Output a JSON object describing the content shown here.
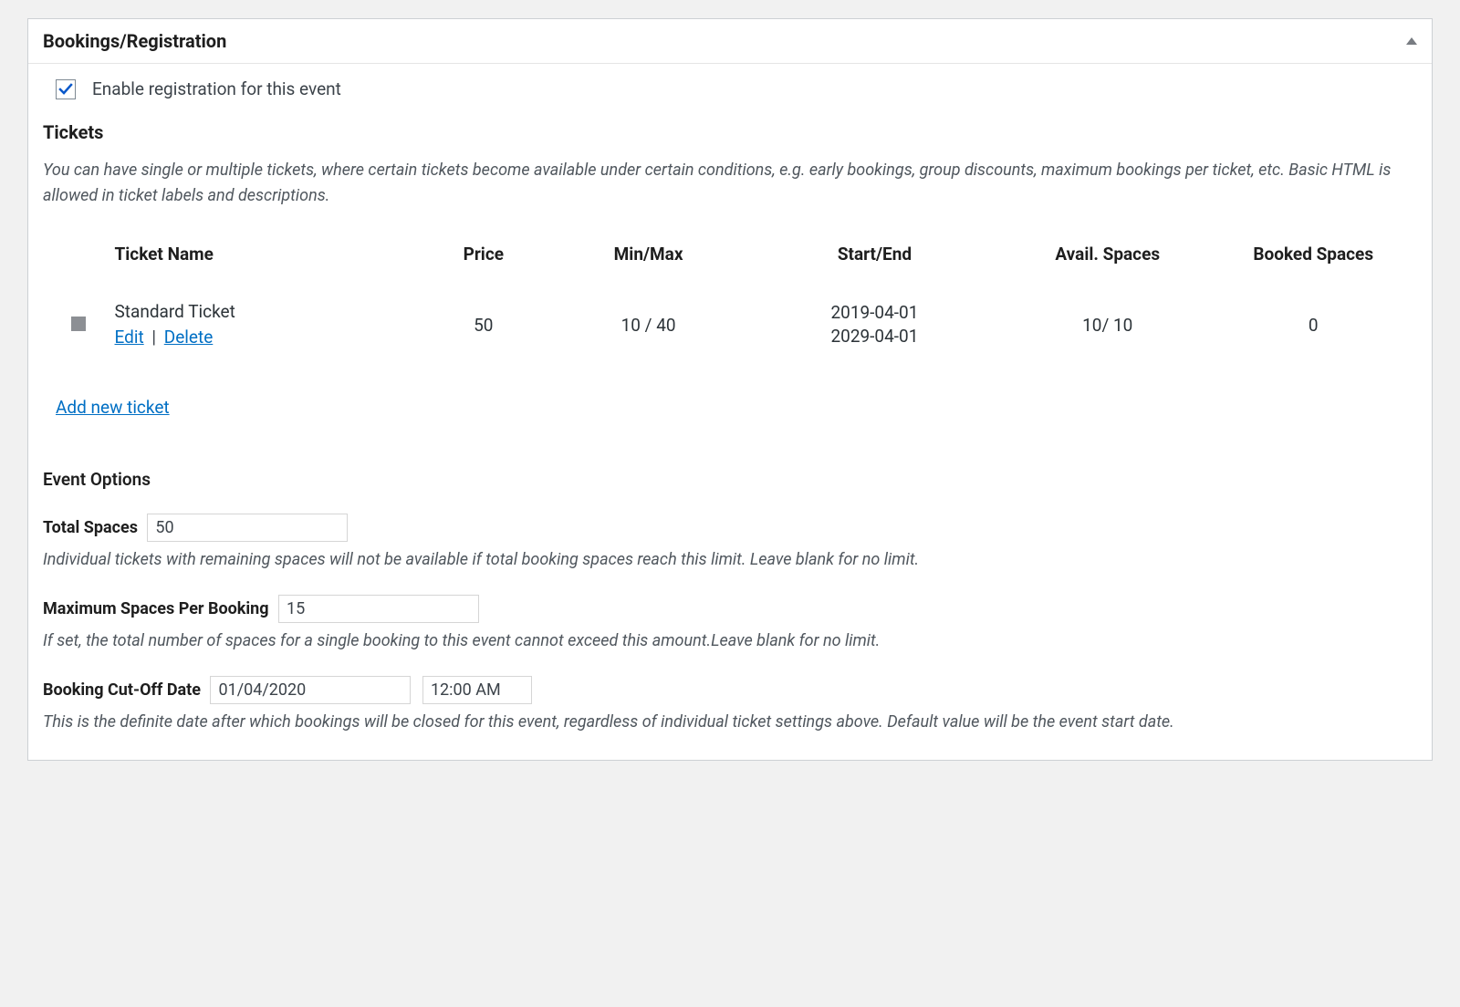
{
  "panel": {
    "title": "Bookings/Registration"
  },
  "enable": {
    "checked": true,
    "label": "Enable registration for this event"
  },
  "tickets": {
    "heading": "Tickets",
    "description": "You can have single or multiple tickets, where certain tickets become available under certain conditions, e.g. early bookings, group discounts, maximum bookings per ticket, etc. Basic HTML is allowed in ticket labels and descriptions.",
    "columns": {
      "name": "Ticket Name",
      "price": "Price",
      "minmax": "Min/Max",
      "startend": "Start/End",
      "avail": "Avail. Spaces",
      "booked": "Booked Spaces"
    },
    "rows": [
      {
        "name": "Standard Ticket",
        "edit_label": "Edit",
        "delete_label": "Delete",
        "price": "50",
        "minmax": "10 / 40",
        "start": "2019-04-01",
        "end": "2029-04-01",
        "avail": "10/ 10",
        "booked": "0"
      }
    ],
    "add_new_label": "Add new ticket"
  },
  "event_options": {
    "heading": "Event Options",
    "total_spaces": {
      "label": "Total Spaces",
      "value": "50",
      "hint": "Individual tickets with remaining spaces will not be available if total booking spaces reach this limit. Leave blank for no limit."
    },
    "max_per_booking": {
      "label": "Maximum Spaces Per Booking",
      "value": "15",
      "hint": "If set, the total number of spaces for a single booking to this event cannot exceed this amount.Leave blank for no limit."
    },
    "cutoff": {
      "label": "Booking Cut-Off Date",
      "date": "01/04/2020",
      "time": "12:00 AM",
      "hint": "This is the definite date after which bookings will be closed for this event, regardless of individual ticket settings above. Default value will be the event start date."
    }
  }
}
